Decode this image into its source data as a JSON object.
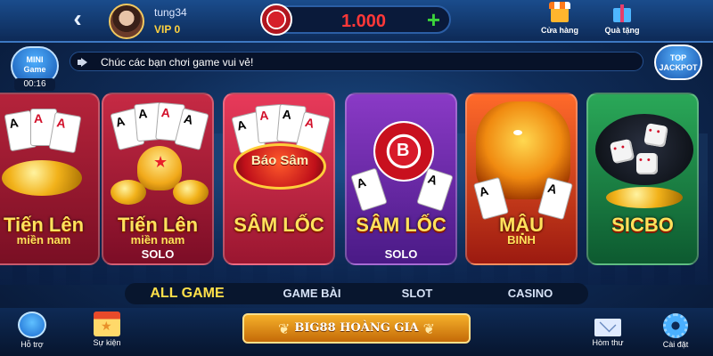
{
  "header": {
    "username": "tung34",
    "vip_label": "VIP  0",
    "balance": "1.000",
    "shop_label": "Cửa hàng",
    "gift_label": "Quà tặng"
  },
  "mini_game": {
    "line1": "MINI",
    "line2": "Game",
    "timer": "00:16"
  },
  "notice": "Chúc các bạn chơi game vui vẻ!",
  "jackpot": {
    "line1": "TOP",
    "line2": "JACKPOT"
  },
  "games": [
    {
      "title1": "Tiến Lên",
      "title2": "miền nam",
      "title3": ""
    },
    {
      "title1": "Tiến Lên",
      "title2": "miền nam",
      "title3": "SOLO"
    },
    {
      "title1": "SÂM LỐC",
      "title2": "",
      "title3": "",
      "badge": "Báo Sâm"
    },
    {
      "title1": "SÂM LỐC",
      "title2": "",
      "title3": "SOLO",
      "chip_letter": "B"
    },
    {
      "title1": "MẬU",
      "title2": "BINH",
      "title3": ""
    },
    {
      "title1": "SICBO",
      "title2": "",
      "title3": ""
    }
  ],
  "tabs": [
    "ALL GAME",
    "GAME BÀI",
    "SLOT",
    "CASINO"
  ],
  "active_tab": "ALL GAME",
  "footer": {
    "support_label": "Hỗ trợ",
    "event_label": "Sự kiện",
    "brand": "BIG88 HOÀNG GIA",
    "mail_label": "Hòm thư",
    "settings_label": "Cài đặt"
  },
  "colors": {
    "balance": "#ff3838",
    "accent_gold": "#ffe04a",
    "plus": "#3bd43b"
  }
}
